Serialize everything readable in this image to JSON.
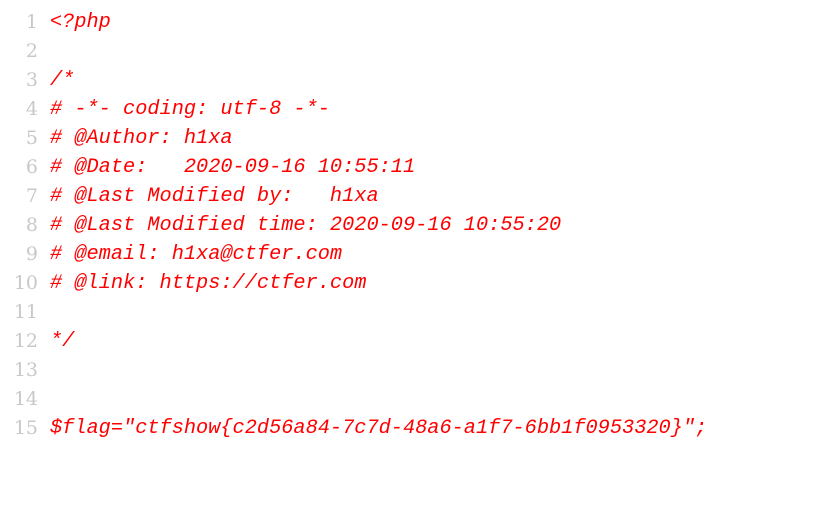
{
  "editor": {
    "text_color": "#ff0000",
    "line_number_color": "#c8c8c8",
    "lines": [
      {
        "num": "1",
        "text": "<?php"
      },
      {
        "num": "2",
        "text": ""
      },
      {
        "num": "3",
        "text": "/*"
      },
      {
        "num": "4",
        "text": "# -*- coding: utf-8 -*-"
      },
      {
        "num": "5",
        "text": "# @Author: h1xa"
      },
      {
        "num": "6",
        "text": "# @Date:   2020-09-16 10:55:11"
      },
      {
        "num": "7",
        "text": "# @Last Modified by:   h1xa"
      },
      {
        "num": "8",
        "text": "# @Last Modified time: 2020-09-16 10:55:20"
      },
      {
        "num": "9",
        "text": "# @email: h1xa@ctfer.com"
      },
      {
        "num": "10",
        "text": "# @link: https://ctfer.com"
      },
      {
        "num": "11",
        "text": ""
      },
      {
        "num": "12",
        "text": "*/"
      },
      {
        "num": "13",
        "text": ""
      },
      {
        "num": "14",
        "text": ""
      },
      {
        "num": "15",
        "text": "$flag=\"ctfshow{c2d56a84-7c7d-48a6-a1f7-6bb1f0953320}\";"
      }
    ]
  }
}
